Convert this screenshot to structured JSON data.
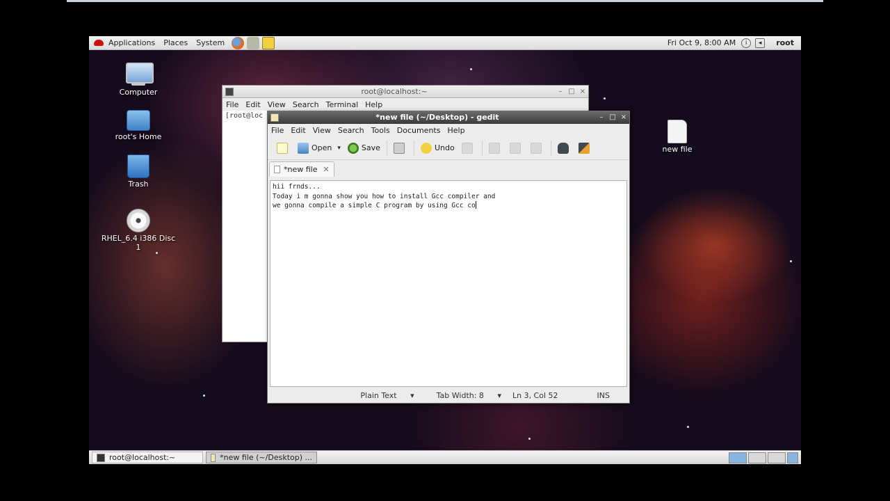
{
  "top_panel": {
    "menus": [
      "Applications",
      "Places",
      "System"
    ],
    "launchers": [
      "firefox-icon",
      "config-icon",
      "notes-icon"
    ],
    "clock": "Fri Oct  9,  8:00 AM",
    "user": "root"
  },
  "desktop": {
    "icons": [
      "Computer",
      "root's Home",
      "Trash",
      "RHEL_6.4 i386 Disc 1",
      "new file"
    ]
  },
  "terminal": {
    "title": "root@localhost:~",
    "menu": [
      "File",
      "Edit",
      "View",
      "Search",
      "Terminal",
      "Help"
    ],
    "prompt": "[root@loc"
  },
  "gedit": {
    "title": "*new file (~/Desktop) - gedit",
    "menu": [
      "File",
      "Edit",
      "View",
      "Search",
      "Tools",
      "Documents",
      "Help"
    ],
    "toolbar": {
      "open": "Open",
      "save": "Save",
      "undo": "Undo"
    },
    "tab": "*new file",
    "lines": [
      "hii frnds...",
      "Today i m gonna show you how to install Gcc compiler and",
      "we gonna compile a simple C program by using Gcc co"
    ],
    "status": {
      "language": "Plain Text",
      "tab_width": "Tab Width:  8",
      "position": "Ln 3, Col 52",
      "mode": "INS"
    }
  },
  "taskbar": {
    "tasks": [
      "root@localhost:~",
      "*new file (~/Desktop) ..."
    ]
  }
}
